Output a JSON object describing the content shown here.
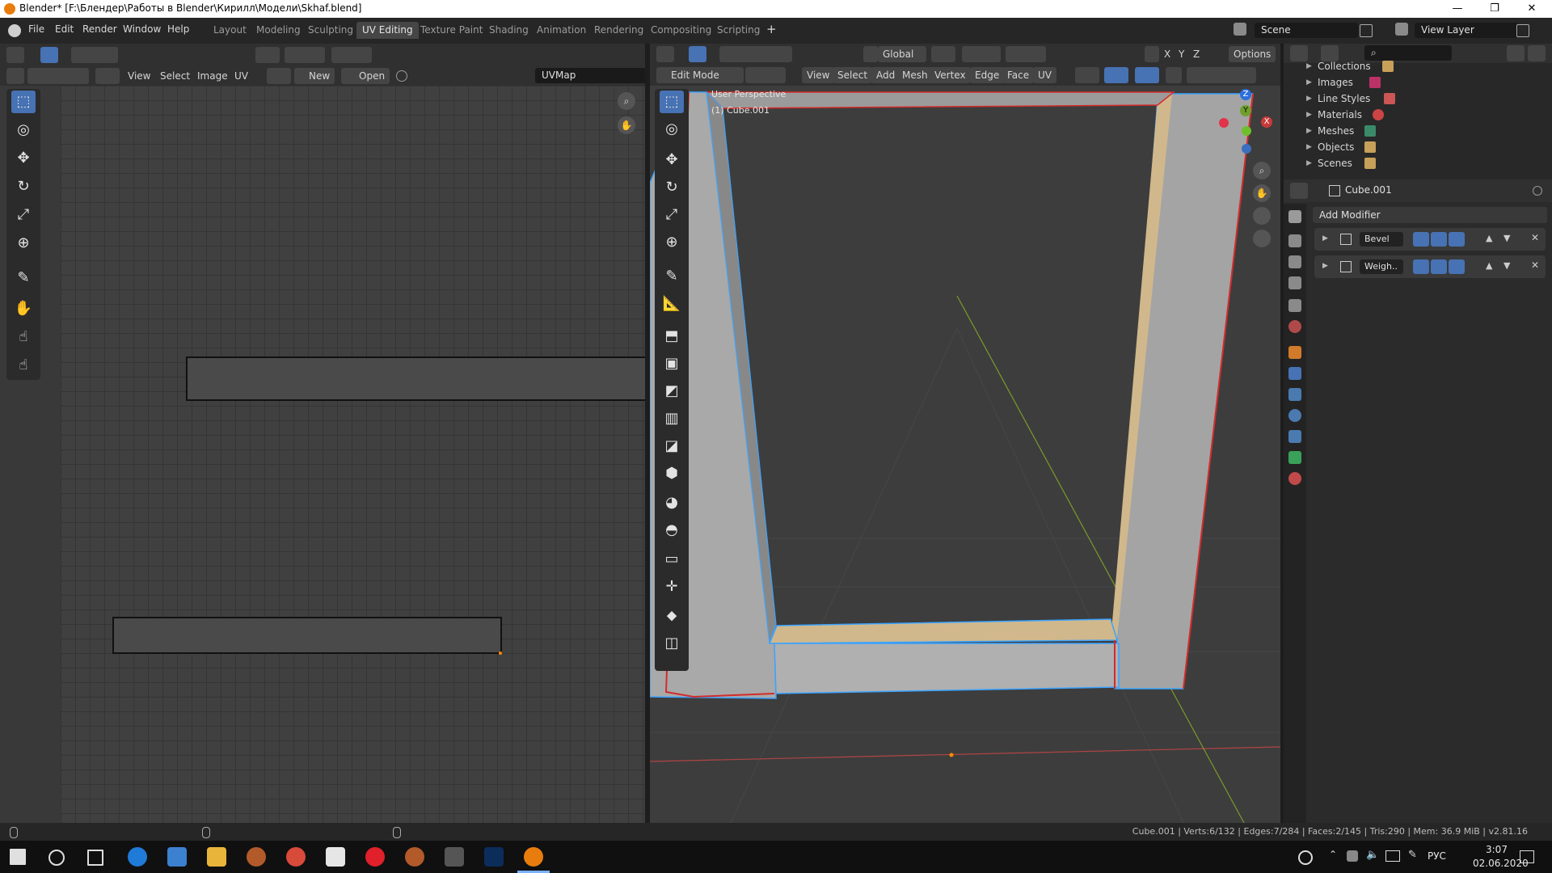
{
  "title_bar": {
    "title": "Blender* [F:\\Блендер\\Работы в Blender\\Кирилл\\Модели\\Skhaf.blend]",
    "minimize": "—",
    "maximize": "❐",
    "close": "✕"
  },
  "top_menu": [
    "File",
    "Edit",
    "Render",
    "Window",
    "Help"
  ],
  "workspace_tabs": [
    "Layout",
    "Modeling",
    "Sculpting",
    "UV Editing",
    "Texture Paint",
    "Shading",
    "Animation",
    "Rendering",
    "Compositing",
    "Scripting"
  ],
  "active_workspace": "UV Editing",
  "add_workspace": "+",
  "scene_field": "Scene",
  "view_layer_field": "View Layer",
  "uv_editor": {
    "menu": [
      "View",
      "Select",
      "Image",
      "UV"
    ],
    "new_label": "New",
    "open_label": "Open",
    "uvmap_field": "UVMap"
  },
  "viewport": {
    "orientation": "Global",
    "options_label": "Options",
    "mode": "Edit Mode",
    "menu": [
      "View",
      "Select",
      "Add",
      "Mesh",
      "Vertex",
      "Edge",
      "Face",
      "UV"
    ],
    "axis_labels": [
      "X",
      "Y",
      "Z"
    ],
    "overlay_text": "User Perspective",
    "object_text": "(1) Cube.001",
    "gizmo_z": "Z",
    "gizmo_y": "Y",
    "gizmo_x": "X"
  },
  "outliner": {
    "items": [
      "Collections",
      "Images",
      "Line Styles",
      "Materials",
      "Meshes",
      "Objects",
      "Scenes"
    ]
  },
  "properties": {
    "object_name": "Cube.001",
    "add_modifier": "Add Modifier",
    "modifiers": [
      {
        "name": "Bevel"
      },
      {
        "name": "Weigh.."
      }
    ]
  },
  "status_bar": {
    "stats": "Cube.001 | Verts:6/132 | Edges:7/284 | Faces:2/145 | Tris:290 | Mem: 36.9 MiB | v2.81.16"
  },
  "taskbar": {
    "lang": "РУС",
    "time": "3:07",
    "date": "02.06.2020"
  },
  "colors": {
    "accent": "#4772b3",
    "selected_edge": "#3aa3ff",
    "boundary_edge": "#d42b2b",
    "face_selected": "#d0b88c"
  }
}
